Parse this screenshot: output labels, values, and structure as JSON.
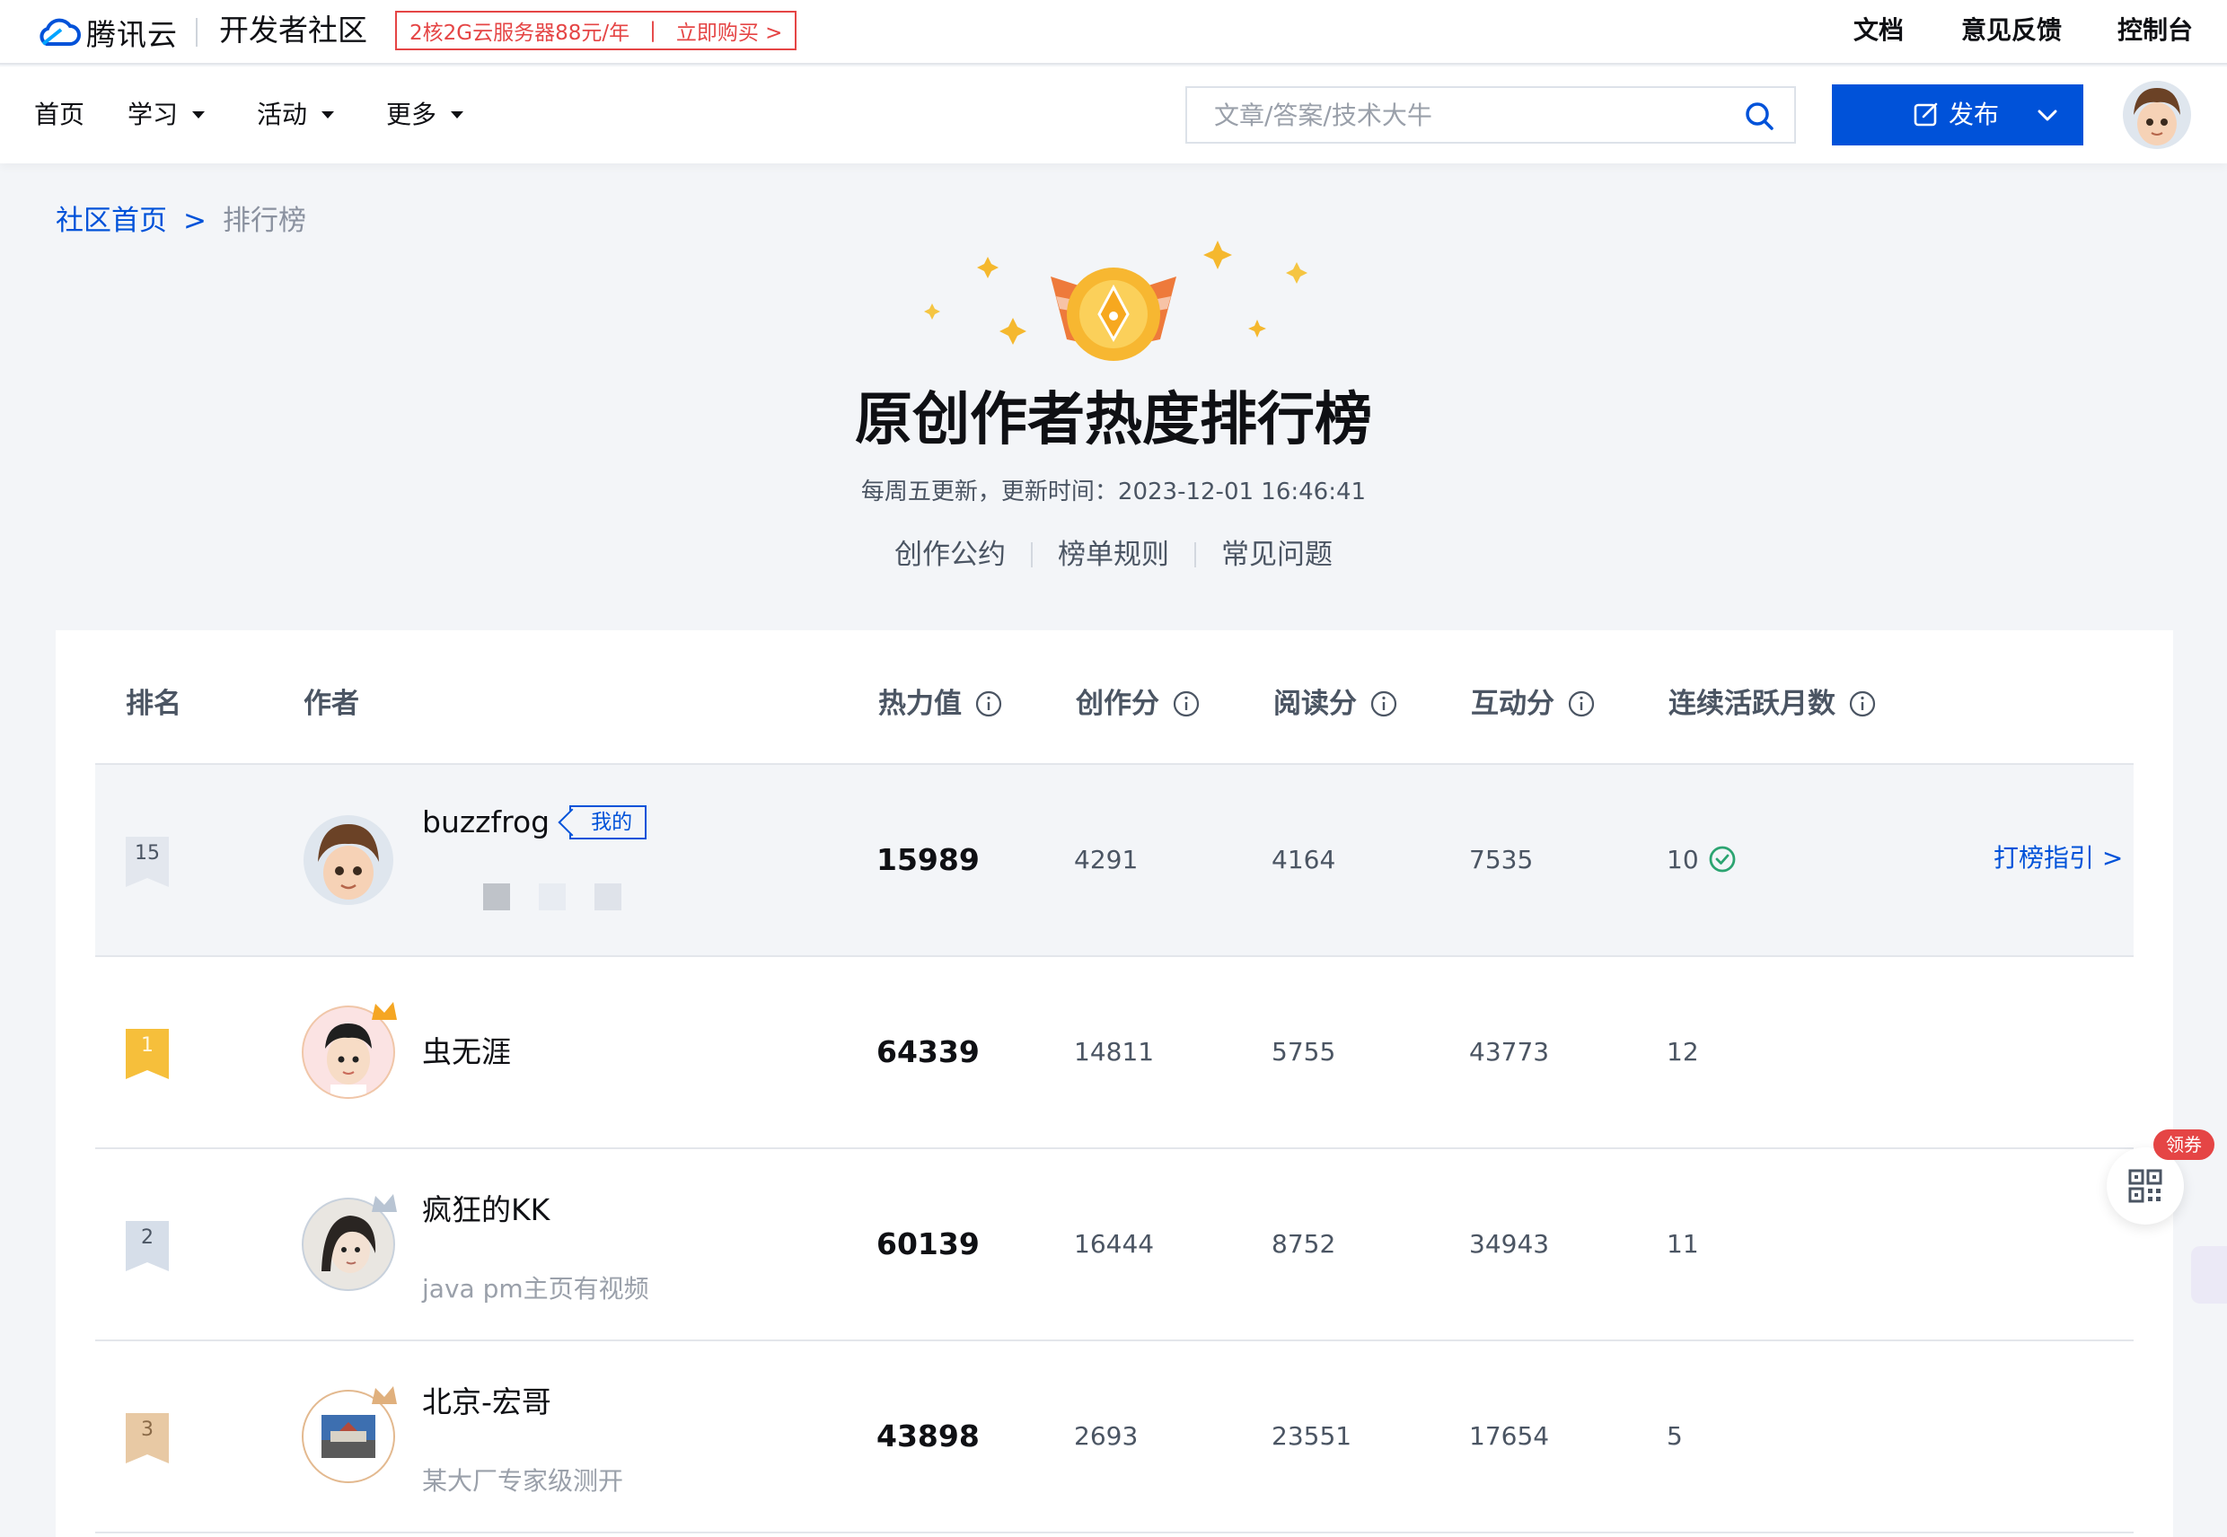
{
  "header": {
    "logo_text": "腾讯云",
    "community": "开发者社区",
    "promo": {
      "text": "2核2G云服务器88元/年",
      "cta": "立即购买 >"
    },
    "links": [
      "文档",
      "意见反馈",
      "控制台"
    ]
  },
  "nav": {
    "items": [
      {
        "label": "首页",
        "dropdown": false
      },
      {
        "label": "学习",
        "dropdown": true
      },
      {
        "label": "活动",
        "dropdown": true
      },
      {
        "label": "更多",
        "dropdown": true
      }
    ],
    "search_placeholder": "文章/答案/技术大牛",
    "publish_label": "发布"
  },
  "breadcrumb": {
    "home": "社区首页",
    "sep": ">",
    "current": "排行榜"
  },
  "hero": {
    "title": "原创作者热度排行榜",
    "subtitle": "每周五更新，更新时间：2023-12-01 16:46:41",
    "links": [
      "创作公约",
      "榜单规则",
      "常见问题"
    ]
  },
  "table": {
    "headers": {
      "rank": "排名",
      "author": "作者",
      "heat": "热力值",
      "creation": "创作分",
      "read": "阅读分",
      "interact": "互动分",
      "active": "连续活跃月数"
    },
    "my_row": {
      "rank": "15",
      "name": "buzzfrog",
      "tag": "我的",
      "heat": "15989",
      "creation": "4291",
      "read": "4164",
      "interact": "7535",
      "active": "10",
      "guide": "打榜指引 >"
    },
    "rows": [
      {
        "rank": "1",
        "name": "虫无涯",
        "subtitle": "",
        "heat": "64339",
        "creation": "14811",
        "read": "5755",
        "interact": "43773",
        "active": "12"
      },
      {
        "rank": "2",
        "name": "疯狂的KK",
        "subtitle": "java pm主页有视频",
        "heat": "60139",
        "creation": "16444",
        "read": "8752",
        "interact": "34943",
        "active": "11"
      },
      {
        "rank": "3",
        "name": "北京-宏哥",
        "subtitle": "某大厂专家级测开",
        "heat": "43898",
        "creation": "2693",
        "read": "23551",
        "interact": "17654",
        "active": "5"
      }
    ]
  },
  "floating": {
    "coupon": "领券"
  },
  "colors": {
    "brand": "#0052d9",
    "promo": "#e54545",
    "gold": "#f5a623",
    "success": "#2ba471"
  }
}
